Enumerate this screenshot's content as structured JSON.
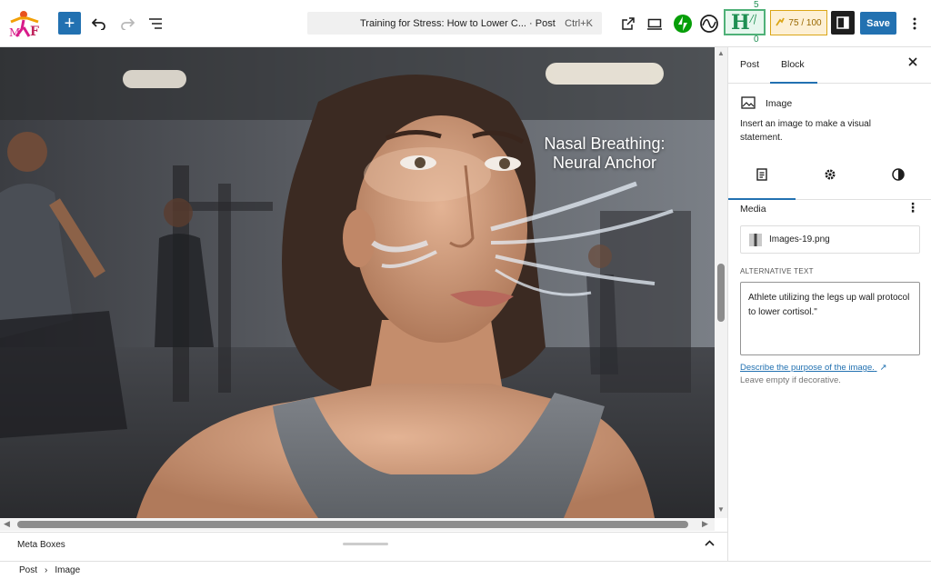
{
  "toolbar": {
    "add_block_icon": "+",
    "undo_icon": "undo-icon",
    "redo_icon": "redo-icon",
    "list_view_icon": "list-view-icon",
    "command_title": "Training for Stress: How to Lower C... · Post",
    "command_shortcut": "Ctrl+K",
    "readability_top": "5",
    "readability_fraction": "/|",
    "readability_bottom": "0",
    "seo_score": "75 / 100",
    "save_label": "Save",
    "colors": {
      "accent": "#2271b1",
      "readability": "#1e8f52",
      "seo": "#dba617"
    }
  },
  "canvas": {
    "overlay_line1": "Nasal Breathing:",
    "overlay_line2": "Neural Anchor"
  },
  "meta_boxes": {
    "label": "Meta Boxes"
  },
  "breadcrumb": {
    "items": [
      "Post",
      "Image"
    ]
  },
  "sidebar": {
    "tabs": {
      "post": "Post",
      "block": "Block"
    },
    "block": {
      "title": "Image",
      "description": "Insert an image to make a visual statement."
    },
    "media": {
      "heading": "Media",
      "file_name": "Images-19.png",
      "alt_label": "ALTERNATIVE TEXT",
      "alt_value": "Athlete utilizing the legs up wall protocol to lower cortisol.\"",
      "describe_link": "Describe the purpose of the image.",
      "hint": "Leave empty if decorative."
    }
  }
}
